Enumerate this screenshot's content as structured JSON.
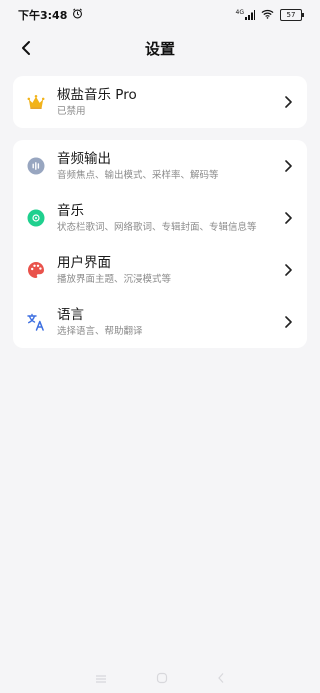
{
  "status": {
    "time": "下午3:48",
    "network": "4G",
    "battery": "57"
  },
  "header": {
    "title": "设置"
  },
  "pro": {
    "label": "椒盐音乐 Pro",
    "sub": "已禁用"
  },
  "items": [
    {
      "label": "音频输出",
      "sub": "音频焦点、输出模式、采样率、解码等"
    },
    {
      "label": "音乐",
      "sub": "状态栏歌词、网络歌词、专辑封面、专辑信息等"
    },
    {
      "label": "用户界面",
      "sub": "播放界面主题、沉浸模式等"
    },
    {
      "label": "语言",
      "sub": "选择语言、帮助翻译"
    }
  ],
  "colors": {
    "background": "#f5f5f7",
    "card": "#ffffff",
    "crown": "#f2b31a",
    "audio": "#98a6c0",
    "music": "#1fd08e",
    "ui": "#e9524b",
    "language": "#3d6fe0"
  }
}
